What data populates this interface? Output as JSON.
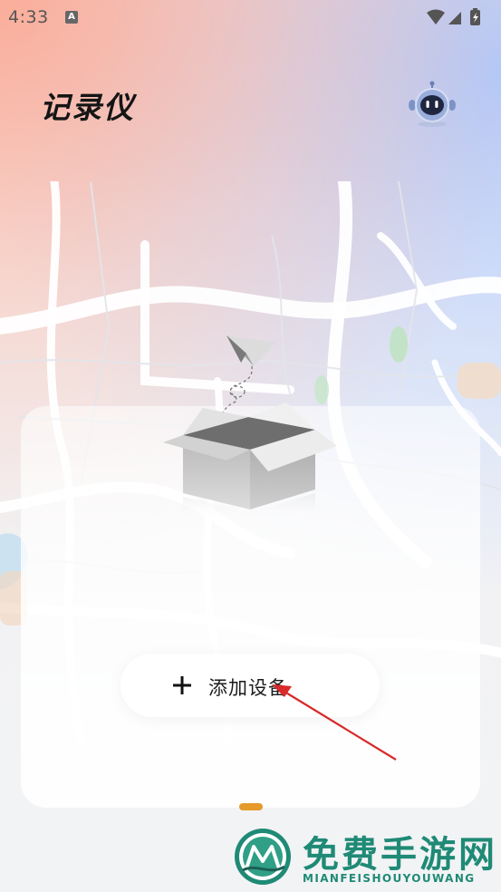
{
  "status_bar": {
    "time": "4:33",
    "notification_icon": "A"
  },
  "header": {
    "title": "记录仪",
    "robot_icon": "robot-assistant-icon"
  },
  "card": {
    "add_device_label": "添加设备"
  },
  "pagination": {
    "pages": 1,
    "active": 1,
    "active_color": "#e59a2b"
  },
  "watermark": {
    "title": "免费手游网",
    "subtitle": "MIANFEISHOUYOUWANG",
    "color": "#1f8a76"
  },
  "colors": {
    "annotation_arrow": "#d82a2a"
  }
}
